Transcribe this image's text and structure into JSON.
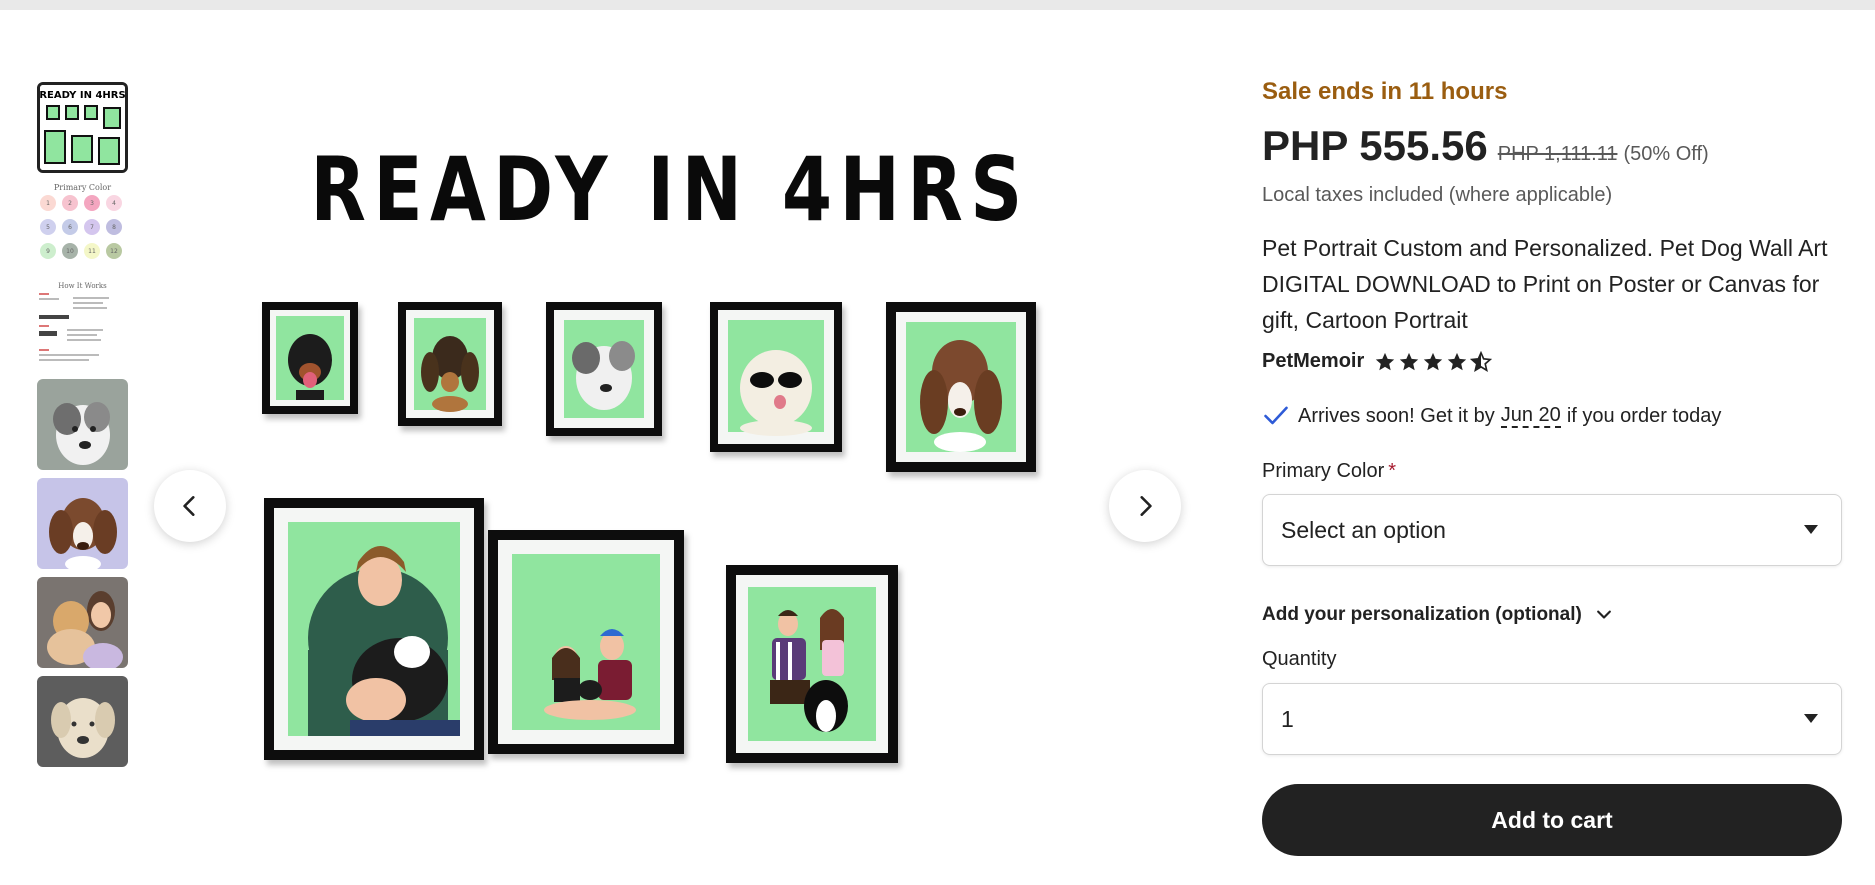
{
  "gallery": {
    "headline": "READY IN 4HRS",
    "thumbnails": [
      {
        "name": "thumbnail-ready-in-4hrs",
        "selected": true
      },
      {
        "name": "thumbnail-primary-color-chart",
        "selected": false
      },
      {
        "name": "thumbnail-how-it-works",
        "selected": false
      },
      {
        "name": "thumbnail-grey-dog",
        "selected": false
      },
      {
        "name": "thumbnail-spaniel",
        "selected": false
      },
      {
        "name": "thumbnail-dog-and-woman",
        "selected": false
      },
      {
        "name": "thumbnail-golden-retriever",
        "selected": false
      }
    ],
    "thumb_mini_title": "READY IN 4HRS",
    "thumb_color_title": "Primary Color",
    "thumb_color_numbers": [
      "1",
      "2",
      "3",
      "4",
      "5",
      "6",
      "7",
      "8",
      "9",
      "10",
      "11",
      "12"
    ],
    "thumb_how_title": "How It Works",
    "frame_bg_color": "#90e59f",
    "prev_icon": "chevron-left-icon",
    "next_icon": "chevron-right-icon"
  },
  "product": {
    "sale_text": "Sale ends in 11 hours",
    "price": "PHP 555.56",
    "original_price": "PHP 1,111.11",
    "discount": "(50% Off)",
    "taxes_note": "Local taxes included (where applicable)",
    "title": "Pet Portrait Custom and Personalized. Pet Dog Wall Art DIGITAL DOWNLOAD to Print on Poster or Canvas for gift, Cartoon Portrait",
    "seller": "PetMemoir",
    "rating": 4.5,
    "arrival_prefix": "Arrives soon! Get it by",
    "arrival_date": "Jun 20",
    "arrival_suffix": "if you order today",
    "primary_color_label": "Primary Color",
    "required_mark": "*",
    "primary_color_value": "Select an option",
    "personalization_label": "Add your personalization (optional)",
    "quantity_label": "Quantity",
    "quantity_value": "1",
    "add_to_cart": "Add to cart",
    "colors": {
      "sale": "#9a5d10",
      "button": "#222222",
      "required": "#a61a2e",
      "check": "#2e5bd7"
    }
  }
}
